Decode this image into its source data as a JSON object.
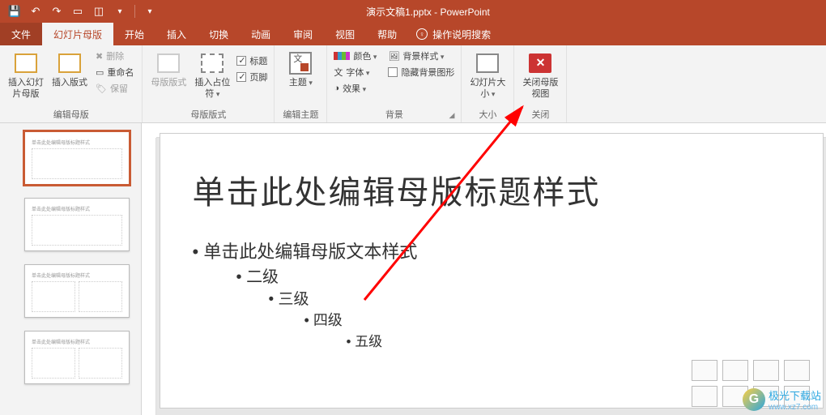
{
  "titlebar": {
    "doc_title": "演示文稿1.pptx  -  PowerPoint"
  },
  "tabs": {
    "file": "文件",
    "slide_master": "幻灯片母版",
    "home": "开始",
    "insert": "插入",
    "transitions": "切换",
    "animations": "动画",
    "review": "审阅",
    "view": "视图",
    "help": "帮助",
    "tellme": "操作说明搜索"
  },
  "ribbon": {
    "edit_master": {
      "insert_slide_master": "插入幻灯片母版",
      "insert_layout": "插入版式",
      "delete": "删除",
      "rename": "重命名",
      "preserve": "保留",
      "label": "编辑母版"
    },
    "master_layout": {
      "master_layout": "母版版式",
      "insert_placeholder": "插入占位符",
      "title_chk": "标题",
      "footer_chk": "页脚",
      "label": "母版版式"
    },
    "edit_theme": {
      "themes": "主题",
      "label": "编辑主题"
    },
    "background": {
      "colors": "颜色",
      "fonts": "字体",
      "effects": "效果",
      "bg_styles": "背景样式",
      "hide_bg": "隐藏背景图形",
      "label": "背景"
    },
    "size": {
      "slide_size": "幻灯片大小",
      "label": "大小"
    },
    "close": {
      "close_master": "关闭母版视图",
      "label": "关闭"
    }
  },
  "slide": {
    "title": "单击此处编辑母版标题样式",
    "l1": "单击此处编辑母版文本样式",
    "l2": "二级",
    "l3": "三级",
    "l4": "四级",
    "l5": "五级"
  },
  "thumb_text": "单击此处编辑母版标题样式",
  "watermark": {
    "name": "极光下载站",
    "url": "www.xz7.com"
  }
}
